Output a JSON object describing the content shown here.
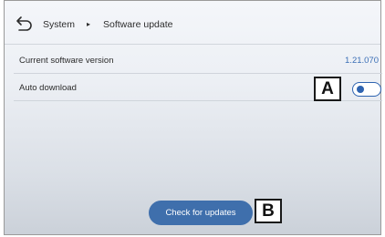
{
  "header": {
    "breadcrumb": [
      "System",
      "Software update"
    ],
    "separator": "▸"
  },
  "settings": [
    {
      "label": "Current software version",
      "value": "1.21.070"
    },
    {
      "label": "Auto download",
      "toggle_on": false
    }
  ],
  "callouts": {
    "a": "A",
    "b": "B"
  },
  "actions": {
    "check_updates_label": "Check for updates"
  },
  "colors": {
    "accent": "#3f6fac",
    "value_text": "#3b6fb6",
    "toggle": "#2e63b0"
  },
  "icons": {
    "back": "back-arrow-icon"
  }
}
